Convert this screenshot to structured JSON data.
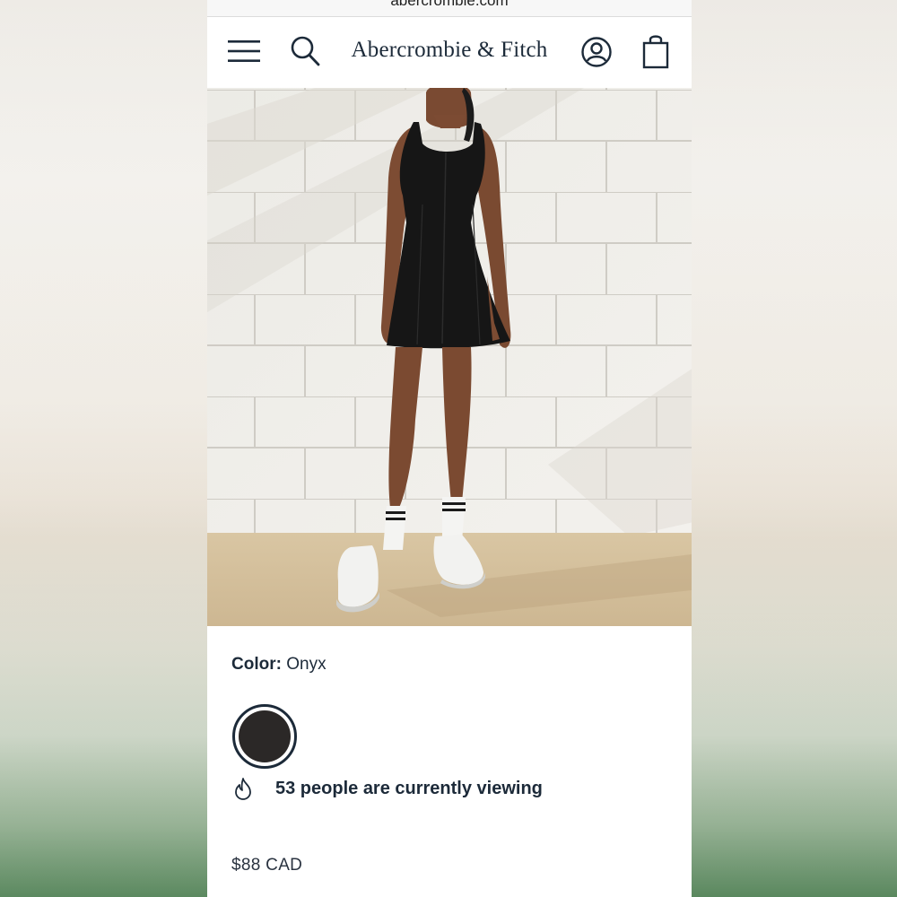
{
  "browser": {
    "url": "abercrombie.com"
  },
  "header": {
    "brand": "Abercrombie & Fitch",
    "icons": [
      "menu-icon",
      "search-icon",
      "account-icon",
      "shopping-bag-icon"
    ]
  },
  "product": {
    "image": "model wearing black sleeveless athletic mini dress with white socks and sneakers against a white brick wall",
    "color_label": "Color:",
    "color_value": "Onyx",
    "swatch_color": "#2b2827",
    "viewing_text": "53 people are currently viewing",
    "price": "$88 CAD"
  },
  "colors": {
    "text_primary": "#1c2a39",
    "background": "#ffffff"
  }
}
